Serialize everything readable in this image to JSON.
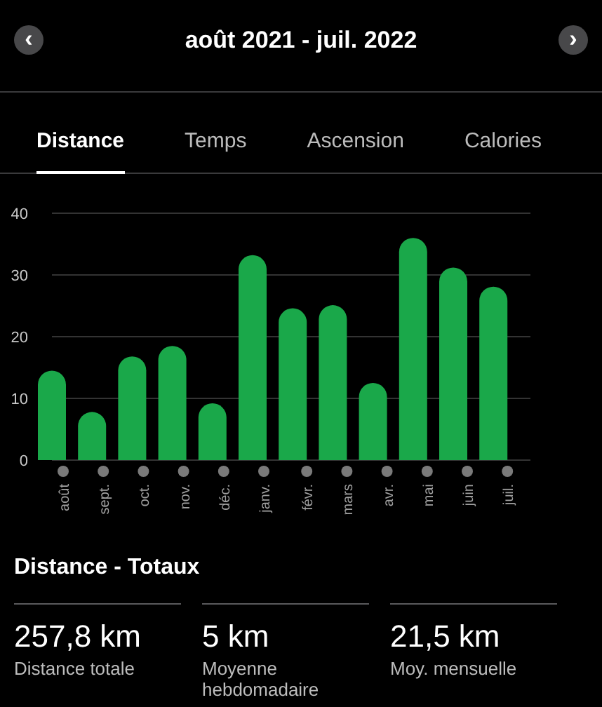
{
  "header": {
    "title": "août 2021 - juil. 2022",
    "prev": "‹",
    "next": "›"
  },
  "tabs": [
    {
      "label": "Distance",
      "selected": true
    },
    {
      "label": "Temps",
      "selected": false
    },
    {
      "label": "Ascension",
      "selected": false
    },
    {
      "label": "Calories",
      "selected": false
    }
  ],
  "chart_data": {
    "type": "bar",
    "categories": [
      "août",
      "sept.",
      "oct.",
      "nov.",
      "déc.",
      "janv.",
      "févr.",
      "mars",
      "avr.",
      "mai",
      "juin",
      "juil."
    ],
    "series": [
      {
        "color": "#1aa84a",
        "values": [
          14.5,
          7.8,
          16.8,
          18.5,
          9.2,
          33.2,
          24.6,
          25.1,
          12.5,
          36,
          31.2,
          28.1
        ]
      }
    ],
    "ylim": [
      0,
      40
    ],
    "grid": true,
    "yticks": [
      0,
      10,
      20,
      30,
      40
    ]
  },
  "totals": {
    "title": "Distance - Totaux",
    "stats": [
      {
        "value": "257,8 km",
        "label": "Distance totale"
      },
      {
        "value": "5 km",
        "label": "Moyenne hebdomadaire"
      },
      {
        "value": "21,5 km",
        "label": "Moy. mensuelle"
      }
    ]
  }
}
